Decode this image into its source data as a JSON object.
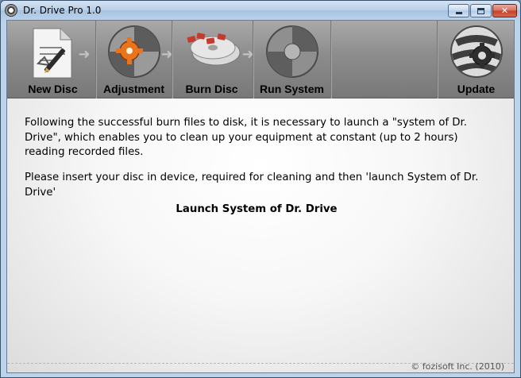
{
  "window": {
    "title": "Dr. Drive Pro 1.0"
  },
  "toolbar": {
    "items": [
      {
        "label": "New Disc",
        "icon": "new-disc-icon"
      },
      {
        "label": "Adjustment",
        "icon": "adjustment-icon"
      },
      {
        "label": "Burn Disc",
        "icon": "burn-disc-icon"
      },
      {
        "label": "Run System",
        "icon": "run-system-icon"
      },
      {
        "label": "Update",
        "icon": "update-icon"
      }
    ]
  },
  "content": {
    "paragraph1": "Following the successful burn files to disk, it is necessary to launch a \"system of Dr. Drive\", which enables you to clean up your equipment at constant (up to 2 hours) reading recorded files.",
    "paragraph2": "Please insert your disc in device, required for cleaning and then 'launch System of Dr. Drive'",
    "launch_link": "Launch System of Dr. Drive"
  },
  "footer": {
    "text": "© fozisoft Inc.  (2010)"
  },
  "colors": {
    "toolbar_bg": "#8c8c8c",
    "accent_orange": "#e8741e",
    "close_button": "#c4402a"
  }
}
